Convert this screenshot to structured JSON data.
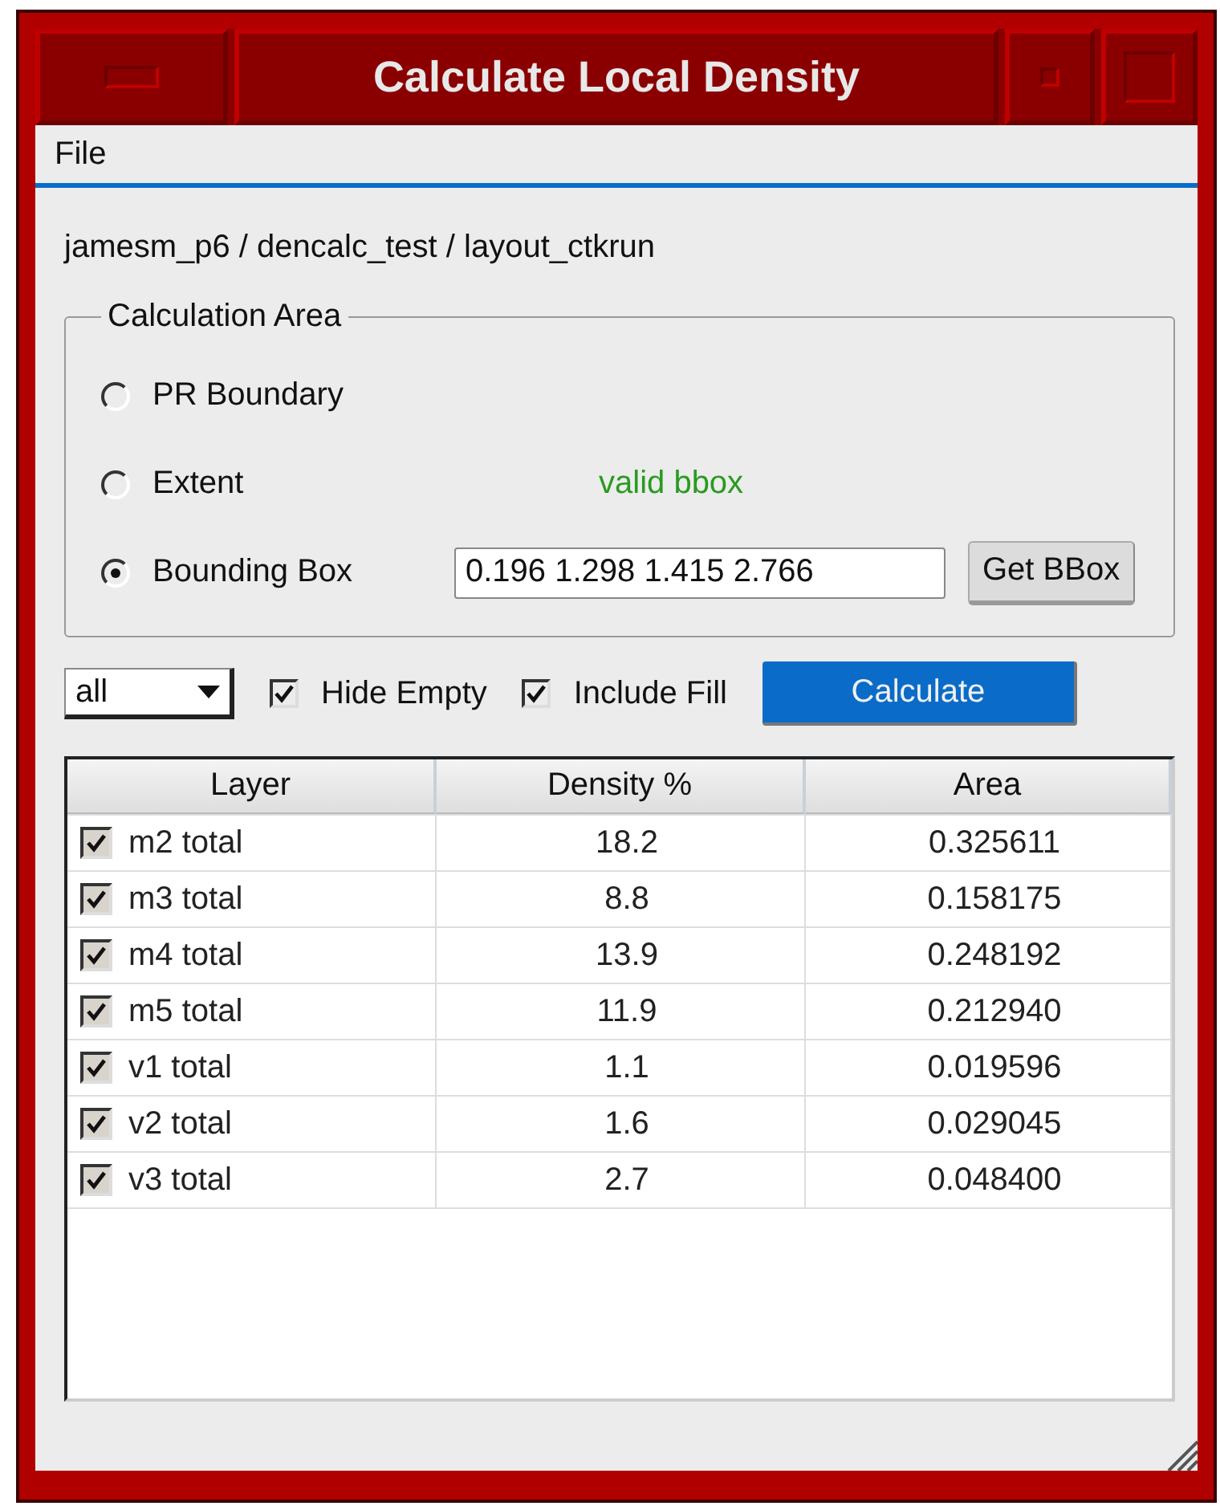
{
  "window": {
    "title": "Calculate Local Density"
  },
  "menu": [
    "File"
  ],
  "path": "jamesm_p6 / dencalc_test / layout_ctkrun",
  "calculation_area": {
    "title": "Calculation Area",
    "options": [
      {
        "label": "PR Boundary",
        "selected": false
      },
      {
        "label": "Extent",
        "selected": false,
        "status": "valid bbox"
      },
      {
        "label": "Bounding Box",
        "selected": true,
        "value": "0.196 1.298 1.415 2.766",
        "button": "Get BBox"
      }
    ]
  },
  "controls": {
    "filter": "all",
    "checks": [
      {
        "label": "Hide Empty",
        "checked": true
      },
      {
        "label": "Include Fill",
        "checked": true
      }
    ],
    "calculate": "Calculate"
  },
  "table": {
    "columns": [
      "Layer",
      "Density %",
      "Area"
    ],
    "rows": [
      {
        "layer": "m2 total",
        "checked": true,
        "density": "18.2",
        "area": "0.325611"
      },
      {
        "layer": "m3 total",
        "checked": true,
        "density": "8.8",
        "area": "0.158175"
      },
      {
        "layer": "m4 total",
        "checked": true,
        "density": "13.9",
        "area": "0.248192"
      },
      {
        "layer": "m5 total",
        "checked": true,
        "density": "11.9",
        "area": "0.212940"
      },
      {
        "layer": "v1 total",
        "checked": true,
        "density": "1.1",
        "area": "0.019596"
      },
      {
        "layer": "v2 total",
        "checked": true,
        "density": "1.6",
        "area": "0.029045"
      },
      {
        "layer": "v3 total",
        "checked": true,
        "density": "2.7",
        "area": "0.048400"
      }
    ]
  }
}
